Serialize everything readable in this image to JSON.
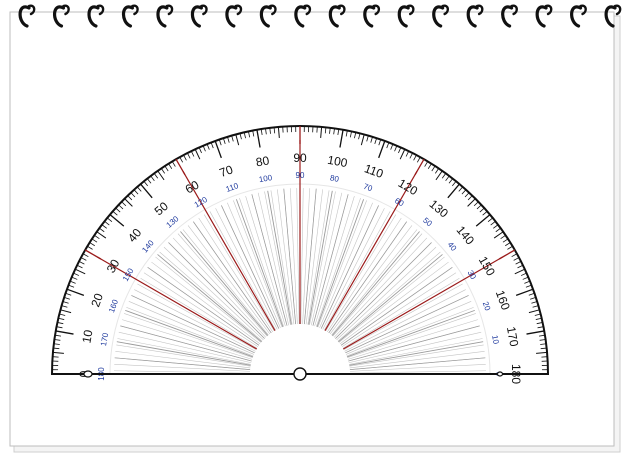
{
  "notebook": {
    "ring_count": 18,
    "ring_color": "#111111",
    "paper_color": "#ffffff",
    "paper_edge_color": "#bdbdbd"
  },
  "protractor": {
    "range_deg": [
      0,
      180
    ],
    "minor_tick_step_deg": 1,
    "mid_tick_step_deg": 5,
    "label_step_deg": 10,
    "outer_scale_labels": [
      "0",
      "10",
      "20",
      "30",
      "40",
      "50",
      "60",
      "70",
      "80",
      "90",
      "100",
      "110",
      "120",
      "130",
      "140",
      "150",
      "160",
      "170",
      "180"
    ],
    "inner_scale_labels": [
      "180",
      "170",
      "160",
      "150",
      "140",
      "130",
      "120",
      "110",
      "100",
      "90",
      "80",
      "70",
      "60",
      "50",
      "40",
      "30",
      "20",
      "10",
      "0"
    ],
    "outline_color": "#111111",
    "outer_label_color": "#111111",
    "inner_label_color": "#1f3a9e",
    "accent_color": "#9b1b1b",
    "radial_line_color": "#9a9a9a",
    "highlight_angles_deg": [
      30,
      60,
      90,
      120,
      150
    ]
  }
}
